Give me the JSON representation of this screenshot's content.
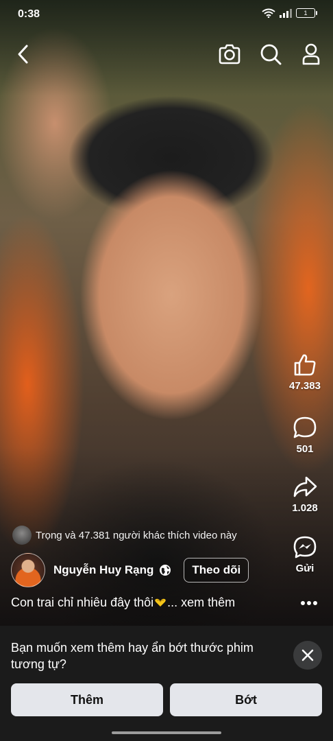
{
  "status_bar": {
    "time": "0:38",
    "battery": "1"
  },
  "nav": {
    "icons": [
      "back-icon",
      "camera-icon",
      "search-icon",
      "profile-icon"
    ]
  },
  "actions": {
    "like_count": "47.383",
    "comment_count": "501",
    "share_count": "1.028",
    "send_label": "Gửi"
  },
  "video_info": {
    "liked_by_text": "Trọng và 47.381 người khác thích video này",
    "author_name": "Nguyễn Huy Rạng",
    "follow_label": "Theo dõi",
    "caption": "Con trai chỉ nhiêu đây thôi",
    "see_more": "... xem thêm"
  },
  "feedback_sheet": {
    "question": "Bạn muốn xem thêm hay ẩn bớt thước phim tương tự?",
    "more_label": "Thêm",
    "less_label": "Bớt"
  },
  "colors": {
    "sheet_background": "#1b1b1b",
    "button_background": "#e4e6eb",
    "accent_heart": "#f5c518"
  }
}
